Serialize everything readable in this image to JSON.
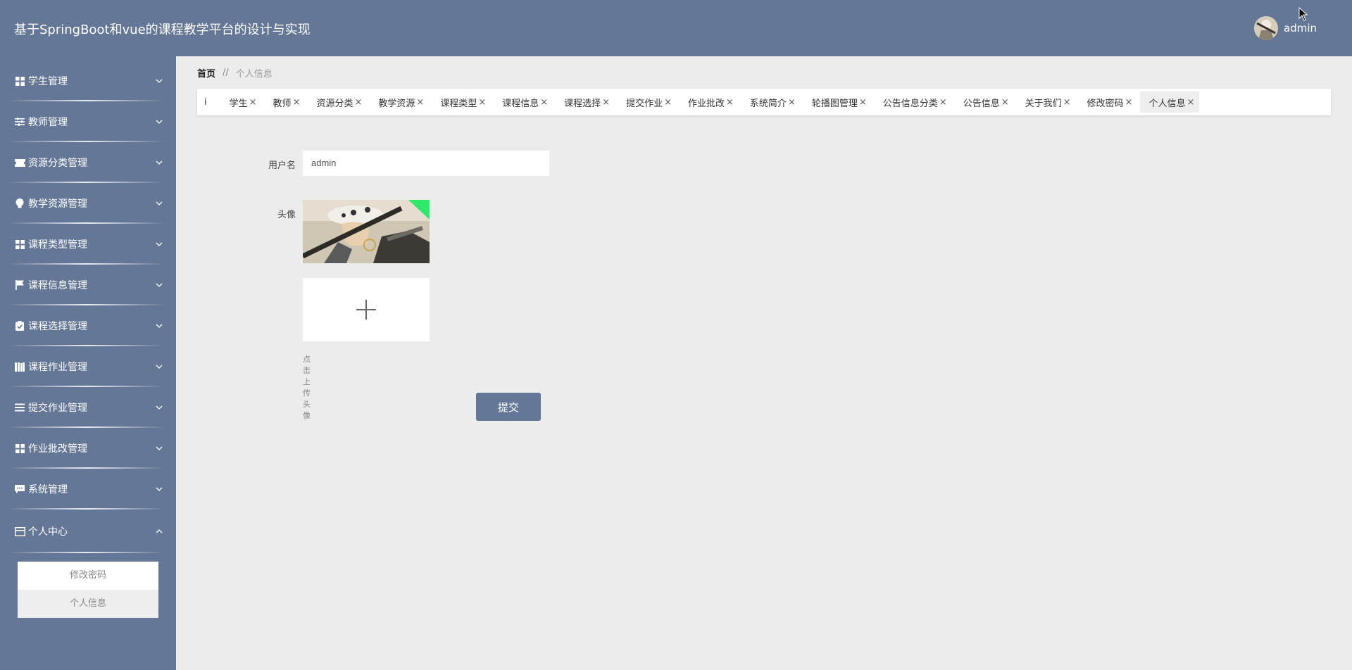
{
  "header": {
    "title": "基于SpringBoot和vue的课程教学平台的设计与实现",
    "username": "admin"
  },
  "sidebar": {
    "items": [
      {
        "label": "学生管理",
        "icon": "grid-icon"
      },
      {
        "label": "教师管理",
        "icon": "sliders-icon"
      },
      {
        "label": "资源分类管理",
        "icon": "ticket-icon"
      },
      {
        "label": "教学资源管理",
        "icon": "bulb-icon"
      },
      {
        "label": "课程类型管理",
        "icon": "grid-icon"
      },
      {
        "label": "课程信息管理",
        "icon": "flag-icon"
      },
      {
        "label": "课程选择管理",
        "icon": "clipboard-check-icon"
      },
      {
        "label": "课程作业管理",
        "icon": "books-icon"
      },
      {
        "label": "提交作业管理",
        "icon": "list-icon"
      },
      {
        "label": "作业批改管理",
        "icon": "grid-icon"
      },
      {
        "label": "系统管理",
        "icon": "chat-icon"
      },
      {
        "label": "个人中心",
        "icon": "card-icon"
      }
    ],
    "submenu": [
      "修改密码",
      "个人信息"
    ]
  },
  "breadcrumb": {
    "home": "首页",
    "separator": "//",
    "current": "个人信息"
  },
  "tags": {
    "fragment": "i",
    "items": [
      "学生",
      "教师",
      "资源分类",
      "教学资源",
      "课程类型",
      "课程信息",
      "课程选择",
      "提交作业",
      "作业批改",
      "系统简介",
      "轮播图管理",
      "公告信息分类",
      "公告信息",
      "关于我们",
      "修改密码",
      "个人信息"
    ],
    "close": "×"
  },
  "form": {
    "username_label": "用户名",
    "username_value": "admin",
    "avatar_label": "头像",
    "upload_tip": "点击上传头像",
    "submit_label": "提交"
  },
  "colors": {
    "primary": "#647797",
    "background": "#ececec"
  }
}
